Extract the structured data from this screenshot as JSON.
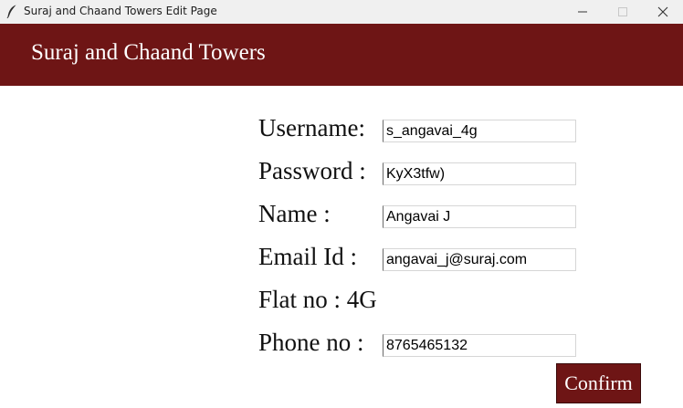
{
  "window": {
    "title": "Suraj and Chaand Towers Edit Page"
  },
  "header": {
    "title": "Suraj and Chaand Towers",
    "background_color": "#6e1515"
  },
  "form": {
    "username": {
      "label": "Username:",
      "value": "s_angavai_4g"
    },
    "password": {
      "label": "Password :",
      "value": "KyX3tfw)"
    },
    "name": {
      "label": "Name :",
      "value": "Angavai J"
    },
    "email": {
      "label": "Email Id :",
      "value": "angavai_j@suraj.com"
    },
    "flat": {
      "label": "Flat no : 4G"
    },
    "phone": {
      "label": "Phone no :",
      "value": "8765465132"
    },
    "confirm_label": "Confirm"
  },
  "icons": {
    "app": "feather-icon",
    "minimize": "minimize-icon",
    "maximize": "maximize-icon",
    "close": "close-icon"
  }
}
